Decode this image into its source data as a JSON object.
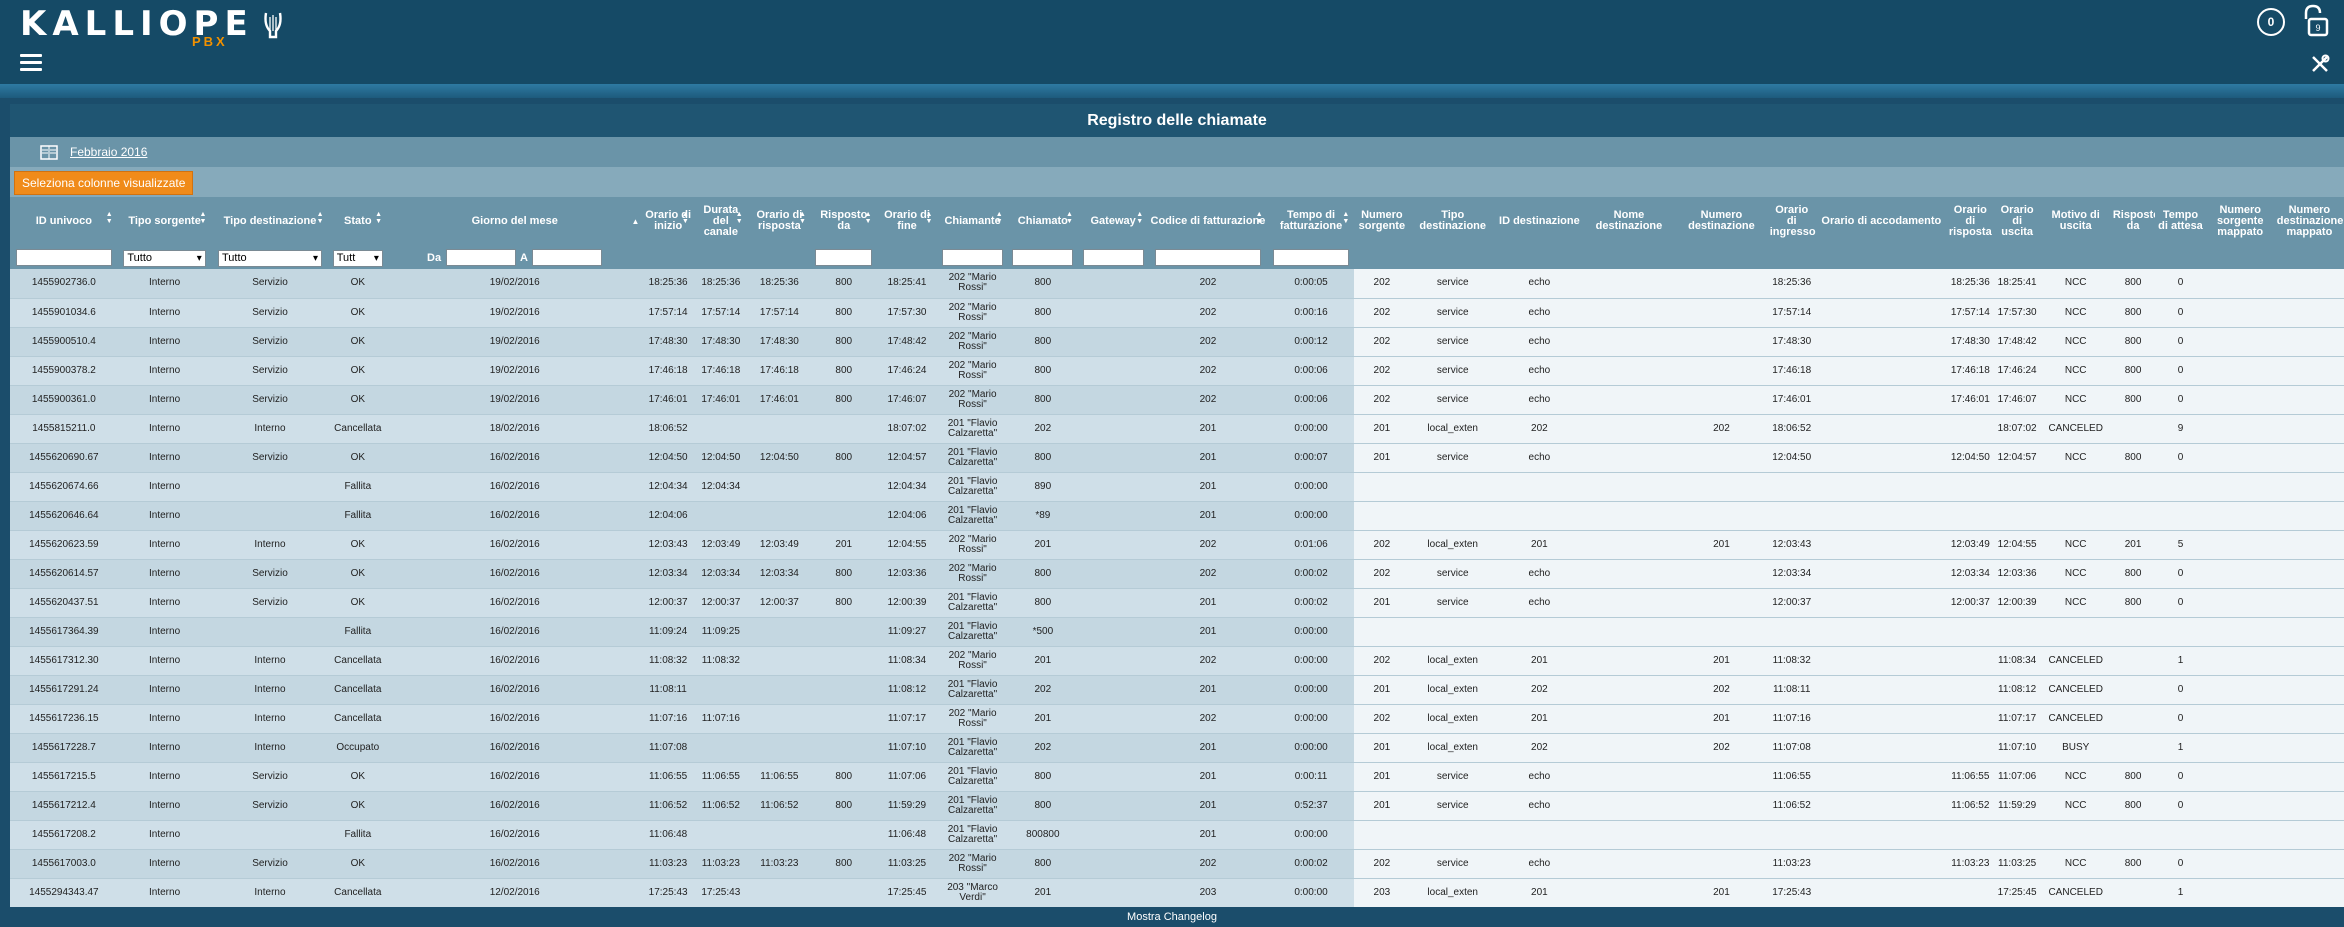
{
  "header": {
    "logo_text": "KALLIOPE",
    "logo_sub": "PBX",
    "notification_count": "0",
    "lock_badge": "9"
  },
  "panel": {
    "title": "Registro delle chiamate",
    "month": "Febbraio 2016",
    "select_columns_label": "Seleziona colonne visualizzate"
  },
  "filters": {
    "tipo_sorgente": "Tutto",
    "tipo_destinazione": "Tutto",
    "stato": "Tutt",
    "da_label": "Da",
    "a_label": "A"
  },
  "columns": [
    "ID univoco",
    "Tipo sorgente",
    "Tipo destinazione",
    "Stato",
    "Giorno del mese",
    "Orario di inizio",
    "Durata del canale",
    "Orario di risposta",
    "Risposto da",
    "Orario di fine",
    "Chiamante",
    "Chiamato",
    "Gateway",
    "Codice di fatturazione",
    "Tempo di fatturazione",
    "Numero sorgente",
    "Tipo destinazione",
    "ID destinazione",
    "Nome destinazione",
    "Numero destinazione",
    "Orario di ingresso",
    "Orario di accodamento",
    "Orario di risposta",
    "Orario di uscita",
    "Motivo di uscita",
    "Risposto da",
    "Tempo di attesa",
    "Numero sorgente mappato",
    "Numero destinazione mappato"
  ],
  "rows": [
    [
      "1455902736.0",
      "Interno",
      "Servizio",
      "OK",
      "19/02/2016",
      "18:25:36",
      "18:25:36",
      "18:25:36",
      "800",
      "18:25:41",
      "202 \"Mario Rossi\"",
      "800",
      "",
      "202",
      "0:00:05",
      "202",
      "service",
      "echo",
      "",
      "",
      "18:25:36",
      "",
      "18:25:36",
      "18:25:41",
      "NCC",
      "800",
      "0",
      "",
      ""
    ],
    [
      "1455901034.6",
      "Interno",
      "Servizio",
      "OK",
      "19/02/2016",
      "17:57:14",
      "17:57:14",
      "17:57:14",
      "800",
      "17:57:30",
      "202 \"Mario Rossi\"",
      "800",
      "",
      "202",
      "0:00:16",
      "202",
      "service",
      "echo",
      "",
      "",
      "17:57:14",
      "",
      "17:57:14",
      "17:57:30",
      "NCC",
      "800",
      "0",
      "",
      ""
    ],
    [
      "1455900510.4",
      "Interno",
      "Servizio",
      "OK",
      "19/02/2016",
      "17:48:30",
      "17:48:30",
      "17:48:30",
      "800",
      "17:48:42",
      "202 \"Mario Rossi\"",
      "800",
      "",
      "202",
      "0:00:12",
      "202",
      "service",
      "echo",
      "",
      "",
      "17:48:30",
      "",
      "17:48:30",
      "17:48:42",
      "NCC",
      "800",
      "0",
      "",
      ""
    ],
    [
      "1455900378.2",
      "Interno",
      "Servizio",
      "OK",
      "19/02/2016",
      "17:46:18",
      "17:46:18",
      "17:46:18",
      "800",
      "17:46:24",
      "202 \"Mario Rossi\"",
      "800",
      "",
      "202",
      "0:00:06",
      "202",
      "service",
      "echo",
      "",
      "",
      "17:46:18",
      "",
      "17:46:18",
      "17:46:24",
      "NCC",
      "800",
      "0",
      "",
      ""
    ],
    [
      "1455900361.0",
      "Interno",
      "Servizio",
      "OK",
      "19/02/2016",
      "17:46:01",
      "17:46:01",
      "17:46:01",
      "800",
      "17:46:07",
      "202 \"Mario Rossi\"",
      "800",
      "",
      "202",
      "0:00:06",
      "202",
      "service",
      "echo",
      "",
      "",
      "17:46:01",
      "",
      "17:46:01",
      "17:46:07",
      "NCC",
      "800",
      "0",
      "",
      ""
    ],
    [
      "1455815211.0",
      "Interno",
      "Interno",
      "Cancellata",
      "18/02/2016",
      "18:06:52",
      "",
      "",
      "",
      "18:07:02",
      "201 \"Flavio Calzaretta\"",
      "202",
      "",
      "201",
      "0:00:00",
      "201",
      "local_exten",
      "202",
      "",
      "202",
      "18:06:52",
      "",
      "",
      "18:07:02",
      "CANCELED",
      "",
      "9",
      "",
      ""
    ],
    [
      "1455620690.67",
      "Interno",
      "Servizio",
      "OK",
      "16/02/2016",
      "12:04:50",
      "12:04:50",
      "12:04:50",
      "800",
      "12:04:57",
      "201 \"Flavio Calzaretta\"",
      "800",
      "",
      "201",
      "0:00:07",
      "201",
      "service",
      "echo",
      "",
      "",
      "12:04:50",
      "",
      "12:04:50",
      "12:04:57",
      "NCC",
      "800",
      "0",
      "",
      ""
    ],
    [
      "1455620674.66",
      "Interno",
      "",
      "Fallita",
      "16/02/2016",
      "12:04:34",
      "12:04:34",
      "",
      "",
      "12:04:34",
      "201 \"Flavio Calzaretta\"",
      "890",
      "",
      "201",
      "0:00:00",
      "",
      "",
      "",
      "",
      "",
      "",
      "",
      "",
      "",
      "",
      "",
      "",
      "",
      ""
    ],
    [
      "1455620646.64",
      "Interno",
      "",
      "Fallita",
      "16/02/2016",
      "12:04:06",
      "",
      "",
      "",
      "12:04:06",
      "201 \"Flavio Calzaretta\"",
      "*89",
      "",
      "201",
      "0:00:00",
      "",
      "",
      "",
      "",
      "",
      "",
      "",
      "",
      "",
      "",
      "",
      "",
      "",
      ""
    ],
    [
      "1455620623.59",
      "Interno",
      "Interno",
      "OK",
      "16/02/2016",
      "12:03:43",
      "12:03:49",
      "12:03:49",
      "201",
      "12:04:55",
      "202 \"Mario Rossi\"",
      "201",
      "",
      "202",
      "0:01:06",
      "202",
      "local_exten",
      "201",
      "",
      "201",
      "12:03:43",
      "",
      "12:03:49",
      "12:04:55",
      "NCC",
      "201",
      "5",
      "",
      ""
    ],
    [
      "1455620614.57",
      "Interno",
      "Servizio",
      "OK",
      "16/02/2016",
      "12:03:34",
      "12:03:34",
      "12:03:34",
      "800",
      "12:03:36",
      "202 \"Mario Rossi\"",
      "800",
      "",
      "202",
      "0:00:02",
      "202",
      "service",
      "echo",
      "",
      "",
      "12:03:34",
      "",
      "12:03:34",
      "12:03:36",
      "NCC",
      "800",
      "0",
      "",
      ""
    ],
    [
      "1455620437.51",
      "Interno",
      "Servizio",
      "OK",
      "16/02/2016",
      "12:00:37",
      "12:00:37",
      "12:00:37",
      "800",
      "12:00:39",
      "201 \"Flavio Calzaretta\"",
      "800",
      "",
      "201",
      "0:00:02",
      "201",
      "service",
      "echo",
      "",
      "",
      "12:00:37",
      "",
      "12:00:37",
      "12:00:39",
      "NCC",
      "800",
      "0",
      "",
      ""
    ],
    [
      "1455617364.39",
      "Interno",
      "",
      "Fallita",
      "16/02/2016",
      "11:09:24",
      "11:09:25",
      "",
      "",
      "11:09:27",
      "201 \"Flavio Calzaretta\"",
      "*500",
      "",
      "201",
      "0:00:00",
      "",
      "",
      "",
      "",
      "",
      "",
      "",
      "",
      "",
      "",
      "",
      "",
      "",
      ""
    ],
    [
      "1455617312.30",
      "Interno",
      "Interno",
      "Cancellata",
      "16/02/2016",
      "11:08:32",
      "11:08:32",
      "",
      "",
      "11:08:34",
      "202 \"Mario Rossi\"",
      "201",
      "",
      "202",
      "0:00:00",
      "202",
      "local_exten",
      "201",
      "",
      "201",
      "11:08:32",
      "",
      "",
      "11:08:34",
      "CANCELED",
      "",
      "1",
      "",
      ""
    ],
    [
      "1455617291.24",
      "Interno",
      "Interno",
      "Cancellata",
      "16/02/2016",
      "11:08:11",
      "",
      "",
      "",
      "11:08:12",
      "201 \"Flavio Calzaretta\"",
      "202",
      "",
      "201",
      "0:00:00",
      "201",
      "local_exten",
      "202",
      "",
      "202",
      "11:08:11",
      "",
      "",
      "11:08:12",
      "CANCELED",
      "",
      "0",
      "",
      ""
    ],
    [
      "1455617236.15",
      "Interno",
      "Interno",
      "Cancellata",
      "16/02/2016",
      "11:07:16",
      "11:07:16",
      "",
      "",
      "11:07:17",
      "202 \"Mario Rossi\"",
      "201",
      "",
      "202",
      "0:00:00",
      "202",
      "local_exten",
      "201",
      "",
      "201",
      "11:07:16",
      "",
      "",
      "11:07:17",
      "CANCELED",
      "",
      "0",
      "",
      ""
    ],
    [
      "1455617228.7",
      "Interno",
      "Interno",
      "Occupato",
      "16/02/2016",
      "11:07:08",
      "",
      "",
      "",
      "11:07:10",
      "201 \"Flavio Calzaretta\"",
      "202",
      "",
      "201",
      "0:00:00",
      "201",
      "local_exten",
      "202",
      "",
      "202",
      "11:07:08",
      "",
      "",
      "11:07:10",
      "BUSY",
      "",
      "1",
      "",
      ""
    ],
    [
      "1455617215.5",
      "Interno",
      "Servizio",
      "OK",
      "16/02/2016",
      "11:06:55",
      "11:06:55",
      "11:06:55",
      "800",
      "11:07:06",
      "201 \"Flavio Calzaretta\"",
      "800",
      "",
      "201",
      "0:00:11",
      "201",
      "service",
      "echo",
      "",
      "",
      "11:06:55",
      "",
      "11:06:55",
      "11:07:06",
      "NCC",
      "800",
      "0",
      "",
      ""
    ],
    [
      "1455617212.4",
      "Interno",
      "Servizio",
      "OK",
      "16/02/2016",
      "11:06:52",
      "11:06:52",
      "11:06:52",
      "800",
      "11:59:29",
      "201 \"Flavio Calzaretta\"",
      "800",
      "",
      "201",
      "0:52:37",
      "201",
      "service",
      "echo",
      "",
      "",
      "11:06:52",
      "",
      "11:06:52",
      "11:59:29",
      "NCC",
      "800",
      "0",
      "",
      ""
    ],
    [
      "1455617208.2",
      "Interno",
      "",
      "Fallita",
      "16/02/2016",
      "11:06:48",
      "",
      "",
      "",
      "11:06:48",
      "201 \"Flavio Calzaretta\"",
      "800800",
      "",
      "201",
      "0:00:00",
      "",
      "",
      "",
      "",
      "",
      "",
      "",
      "",
      "",
      "",
      "",
      "",
      "",
      ""
    ],
    [
      "1455617003.0",
      "Interno",
      "Servizio",
      "OK",
      "16/02/2016",
      "11:03:23",
      "11:03:23",
      "11:03:23",
      "800",
      "11:03:25",
      "202 \"Mario Rossi\"",
      "800",
      "",
      "202",
      "0:00:02",
      "202",
      "service",
      "echo",
      "",
      "",
      "11:03:23",
      "",
      "11:03:23",
      "11:03:25",
      "NCC",
      "800",
      "0",
      "",
      ""
    ],
    [
      "1455294343.47",
      "Interno",
      "Interno",
      "Cancellata",
      "12/02/2016",
      "17:25:43",
      "17:25:43",
      "",
      "",
      "17:25:45",
      "203 \"Marco Verdi\"",
      "201",
      "",
      "203",
      "0:00:00",
      "203",
      "local_exten",
      "201",
      "",
      "201",
      "17:25:43",
      "",
      "",
      "17:25:45",
      "CANCELED",
      "",
      "1",
      "",
      ""
    ]
  ],
  "footer": {
    "changelog": "Mostra Changelog"
  }
}
